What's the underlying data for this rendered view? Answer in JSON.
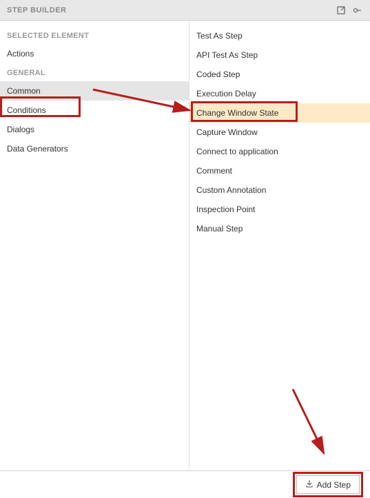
{
  "header": {
    "title": "STEP BUILDER"
  },
  "leftPanel": {
    "section1": "SELECTED ELEMENT",
    "items1": [
      "Actions"
    ],
    "section2": "GENERAL",
    "items2": [
      "Common",
      "Conditions",
      "Dialogs",
      "Data Generators"
    ],
    "selected": "Common"
  },
  "rightPanel": {
    "items": [
      "Test As Step",
      "API Test As Step",
      "Coded Step",
      "Execution Delay",
      "Change Window State",
      "Capture Window",
      "Connect to application",
      "Comment",
      "Custom Annotation",
      "Inspection Point",
      "Manual Step"
    ],
    "selected": "Change Window State"
  },
  "footer": {
    "addLabel": "Add Step"
  }
}
